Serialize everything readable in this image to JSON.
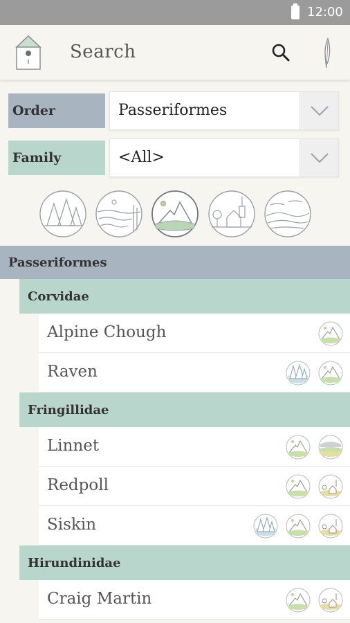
{
  "status_bar": {
    "time": "12:00",
    "battery_icon": "battery-full-icon"
  },
  "app_bar": {
    "title": "Search",
    "home_icon": "birdhouse-icon",
    "search_icon": "search-icon",
    "feather_icon": "feather-icon"
  },
  "filters": {
    "order": {
      "label": "Order",
      "value": "Passeriformes",
      "dropdown_icon": "chevron-down-icon"
    },
    "family": {
      "label": "Family",
      "value": "<All>",
      "dropdown_icon": "chevron-down-icon"
    }
  },
  "habitats": [
    {
      "name": "forest",
      "icon": "forest-habitat-icon",
      "selected": false
    },
    {
      "name": "wetland",
      "icon": "wetland-habitat-icon",
      "selected": false
    },
    {
      "name": "mountain",
      "icon": "mountain-habitat-icon",
      "selected": true
    },
    {
      "name": "village",
      "icon": "village-habitat-icon",
      "selected": false
    },
    {
      "name": "meadow",
      "icon": "meadow-habitat-icon",
      "selected": false
    }
  ],
  "results": {
    "order": "Passeriformes",
    "families": [
      {
        "name": "Corvidae",
        "species": [
          {
            "name": "Alpine Chough",
            "habitats": [
              "mountain"
            ]
          },
          {
            "name": "Raven",
            "habitats": [
              "forest",
              "mountain"
            ]
          }
        ]
      },
      {
        "name": "Fringillidae",
        "species": [
          {
            "name": "Linnet",
            "habitats": [
              "mountain",
              "meadow"
            ]
          },
          {
            "name": "Redpoll",
            "habitats": [
              "mountain",
              "village"
            ]
          },
          {
            "name": "Siskin",
            "habitats": [
              "forest",
              "mountain",
              "village"
            ]
          }
        ]
      },
      {
        "name": "Hirundinidae",
        "species": [
          {
            "name": "Craig Martin",
            "habitats": [
              "mountain",
              "village"
            ]
          }
        ]
      }
    ]
  },
  "colors": {
    "order_bg": "#a8b4c0",
    "family_bg": "#b9d6cc",
    "page_bg": "#f7f5ef",
    "status_bar": "#9b9b9b"
  }
}
